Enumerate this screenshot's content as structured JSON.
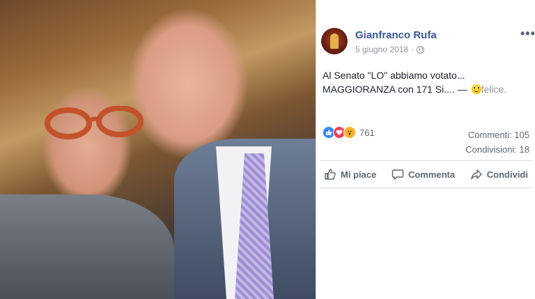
{
  "post": {
    "author": "Gianfranco Rufa",
    "date": "5 giugno 2018",
    "separator": "·",
    "text": "Al Senato \"LO\" abbiamo votato... MAGGIORANZA con 171 Si.... —",
    "feeling": "felice.",
    "more_label": "•••"
  },
  "reactions": {
    "types": [
      "like-icon",
      "love-icon",
      "wow-icon"
    ],
    "count": "761"
  },
  "stats": {
    "comments": "Commenti: 105",
    "shares": "Condivisioni: 18"
  },
  "actions": {
    "like": "Mi piace",
    "comment": "Commenta",
    "share": "Condividi"
  },
  "colors": {
    "author_link": "#385898",
    "meta_grey": "#90949c",
    "action_grey": "#606770",
    "like_blue": "#2d88ff",
    "love_red": "#f33e58",
    "wow_yellow": "#f7b125"
  }
}
